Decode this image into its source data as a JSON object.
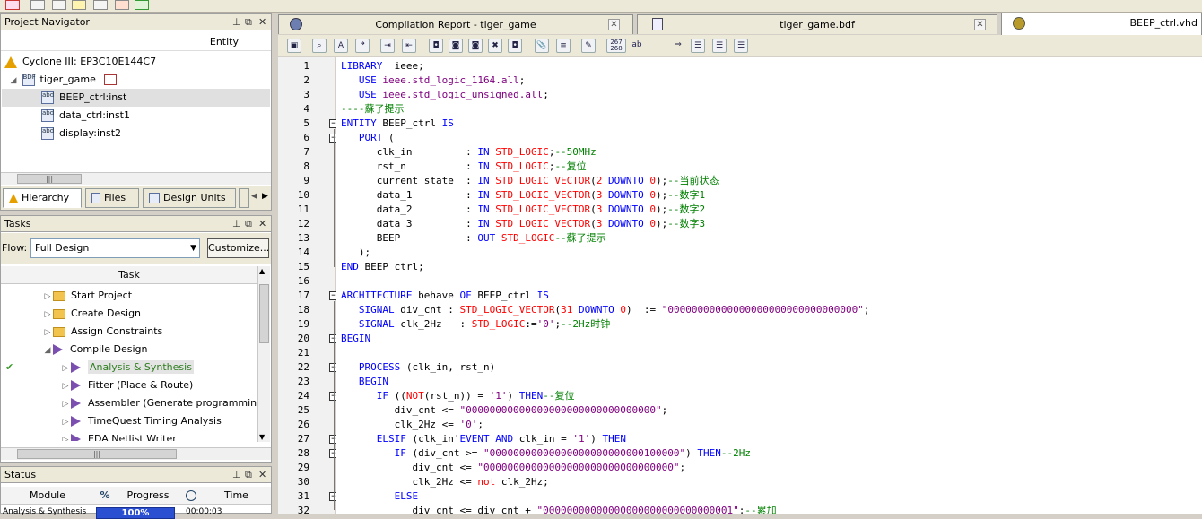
{
  "nav": {
    "title": "Project Navigator",
    "column": "Entity",
    "device": "Cyclone III: EP3C10E144C7",
    "top": "tiger_game",
    "children": [
      "BEEP_ctrl:inst",
      "data_ctrl:inst1",
      "display:inst2"
    ],
    "tabs": [
      "Hierarchy",
      "Files",
      "Design Units"
    ]
  },
  "tasks": {
    "title": "Tasks",
    "flow_label": "Flow:",
    "flow_value": "Full Design",
    "customize": "Customize...",
    "col": "Task",
    "items": [
      {
        "label": "Start Project",
        "icon": "folder",
        "indent": 1,
        "status": ""
      },
      {
        "label": "Create Design",
        "icon": "folder",
        "indent": 1,
        "status": ""
      },
      {
        "label": "Assign Constraints",
        "icon": "folder",
        "indent": 1,
        "status": ""
      },
      {
        "label": "Compile Design",
        "icon": "play",
        "indent": 1,
        "status": "",
        "expanded": true
      },
      {
        "label": "Analysis & Synthesis",
        "icon": "play",
        "indent": 2,
        "status": "done",
        "highlight": true
      },
      {
        "label": "Fitter (Place & Route)",
        "icon": "play",
        "indent": 2,
        "status": ""
      },
      {
        "label": "Assembler (Generate programming files)",
        "icon": "play",
        "indent": 2,
        "status": ""
      },
      {
        "label": "TimeQuest Timing Analysis",
        "icon": "play",
        "indent": 2,
        "status": ""
      },
      {
        "label": "EDA Netlist Writer",
        "icon": "play",
        "indent": 2,
        "status": ""
      }
    ]
  },
  "status": {
    "title": "Status",
    "cols": [
      "Module",
      "%",
      "Progress",
      "Time"
    ],
    "row": {
      "module": "Analysis & Synthesis",
      "progress": "100%",
      "progress_value": 100,
      "time": "00:00:03"
    }
  },
  "doc_tabs": [
    "Compilation Report - tiger_game",
    "tiger_game.bdf",
    "BEEP_ctrl.vhd"
  ],
  "code": {
    "lines": [
      [
        [
          "k",
          "LIBRARY"
        ],
        [
          "",
          "  ieee;"
        ]
      ],
      [
        [
          "",
          "   "
        ],
        [
          "k",
          "USE"
        ],
        [
          "",
          ""
        ],
        [
          "s",
          " ieee.std_logic_1164.all"
        ],
        [
          "",
          ";"
        ]
      ],
      [
        [
          "",
          "   "
        ],
        [
          "k",
          "USE"
        ],
        [
          "s",
          " ieee.std_logic_unsigned.all"
        ],
        [
          "",
          ";"
        ]
      ],
      [
        [
          "c",
          "----蘇了提示"
        ]
      ],
      [
        [
          "k",
          "ENTITY"
        ],
        [
          "",
          ""
        ],
        [
          "",
          ""
        ],
        [
          "",
          " BEEP_ctrl "
        ],
        [
          "k",
          "IS"
        ]
      ],
      [
        [
          "",
          "   "
        ],
        [
          "k",
          "PORT"
        ],
        [
          "",
          "",
          " "
        ],
        [
          "",
          ""
        ],
        [
          "",
          " ("
        ]
      ],
      [
        [
          "",
          "      clk_in         : "
        ],
        [
          "k",
          "IN"
        ],
        [
          "",
          " "
        ],
        [
          "t",
          "STD_LOGIC"
        ],
        [
          "",
          ";"
        ],
        [
          "c",
          "--50MHz"
        ]
      ],
      [
        [
          "",
          "      rst_n          : "
        ],
        [
          "k",
          "IN"
        ],
        [
          "",
          " "
        ],
        [
          "t",
          "STD_LOGIC"
        ],
        [
          "",
          ";"
        ],
        [
          "c",
          "--复位"
        ]
      ],
      [
        [
          "",
          "      current_state  : "
        ],
        [
          "k",
          "IN"
        ],
        [
          "",
          " "
        ],
        [
          "t",
          "STD_LOGIC_VECTOR"
        ],
        [
          "",
          "("
        ],
        [
          "t",
          "2"
        ],
        [
          "",
          " "
        ],
        [
          "k",
          "DOWNTO"
        ],
        [
          "",
          " "
        ],
        [
          "t",
          "0"
        ],
        [
          "",
          ");"
        ],
        [
          "c",
          "--当前状态"
        ]
      ],
      [
        [
          "",
          "      data_1         : "
        ],
        [
          "k",
          "IN"
        ],
        [
          "",
          " "
        ],
        [
          "t",
          "STD_LOGIC_VECTOR"
        ],
        [
          "",
          "("
        ],
        [
          "t",
          "3"
        ],
        [
          "",
          " "
        ],
        [
          "k",
          "DOWNTO"
        ],
        [
          "",
          " "
        ],
        [
          "t",
          "0"
        ],
        [
          "",
          ");"
        ],
        [
          "c",
          "--数字1"
        ]
      ],
      [
        [
          "",
          "      data_2         : "
        ],
        [
          "k",
          "IN"
        ],
        [
          "",
          " "
        ],
        [
          "t",
          "STD_LOGIC_VECTOR"
        ],
        [
          "",
          "("
        ],
        [
          "t",
          "3"
        ],
        [
          "",
          " "
        ],
        [
          "k",
          "DOWNTO"
        ],
        [
          "",
          " "
        ],
        [
          "t",
          "0"
        ],
        [
          "",
          ");"
        ],
        [
          "c",
          "--数字2"
        ]
      ],
      [
        [
          "",
          "      data_3         : "
        ],
        [
          "k",
          "IN"
        ],
        [
          "",
          " "
        ],
        [
          "t",
          "STD_LOGIC_VECTOR"
        ],
        [
          "",
          "("
        ],
        [
          "t",
          "3"
        ],
        [
          "",
          " "
        ],
        [
          "k",
          "DOWNTO"
        ],
        [
          "",
          " "
        ],
        [
          "t",
          "0"
        ],
        [
          "",
          ");"
        ],
        [
          "c",
          "--数字3"
        ]
      ],
      [
        [
          "",
          "      BEEP           : "
        ],
        [
          "k",
          "OUT"
        ],
        [
          "",
          " "
        ],
        [
          "t",
          "STD_LOGIC"
        ],
        [
          "c",
          "--蘇了提示"
        ]
      ],
      [
        [
          "",
          "   );"
        ]
      ],
      [
        [
          "k",
          "END"
        ],
        [
          "",
          " BEEP_ctrl;"
        ]
      ],
      [
        [
          "",
          ""
        ]
      ],
      [
        [
          "k",
          "ARCHITECTURE"
        ],
        [
          "",
          " behave "
        ],
        [
          "k",
          "OF"
        ],
        [
          "",
          " BEEP_ctrl "
        ],
        [
          "k",
          "IS"
        ]
      ],
      [
        [
          "",
          "   "
        ],
        [
          "k",
          "SIGNAL"
        ],
        [
          "",
          " div_cnt : "
        ],
        [
          "t",
          "STD_LOGIC_VECTOR"
        ],
        [
          "",
          "("
        ],
        [
          "t",
          "31"
        ],
        [
          "",
          " "
        ],
        [
          "k",
          "DOWNTO"
        ],
        [
          "",
          " "
        ],
        [
          "t",
          "0"
        ],
        [
          "",
          ")  := "
        ],
        [
          "s",
          "\"00000000000000000000000000000000\""
        ],
        [
          "",
          ";"
        ]
      ],
      [
        [
          "",
          "   "
        ],
        [
          "k",
          "SIGNAL"
        ],
        [
          "",
          " clk_2Hz   : "
        ],
        [
          "t",
          "STD_LOGIC"
        ],
        [
          "",
          ":="
        ],
        [
          "s",
          "'0'"
        ],
        [
          "",
          ";"
        ],
        [
          "c",
          "--2Hz时钟"
        ]
      ],
      [
        [
          "k",
          "BEGIN"
        ]
      ],
      [
        [
          "",
          ""
        ]
      ],
      [
        [
          "",
          "   "
        ],
        [
          "k",
          "PROCESS"
        ],
        [
          "",
          " (clk_in, rst_n)"
        ]
      ],
      [
        [
          "",
          "   "
        ],
        [
          "k",
          "BEGIN"
        ]
      ],
      [
        [
          "",
          "      "
        ],
        [
          "k",
          "IF"
        ],
        [
          "",
          " (("
        ],
        [
          "t",
          "NOT"
        ],
        [
          "",
          "(rst_n)) = "
        ],
        [
          "s",
          "'1'"
        ],
        [
          "",
          ") "
        ],
        [
          "k",
          "THEN"
        ],
        [
          "c",
          "--复位"
        ]
      ],
      [
        [
          "",
          "         div_cnt <= "
        ],
        [
          "s",
          "\"00000000000000000000000000000000\""
        ],
        [
          "",
          ";"
        ]
      ],
      [
        [
          "",
          "         clk_2Hz <= "
        ],
        [
          "s",
          "'0'"
        ],
        [
          "",
          ";"
        ]
      ],
      [
        [
          "",
          "      "
        ],
        [
          "k",
          "ELSIF"
        ],
        [
          "",
          " (clk_in'"
        ],
        [
          "k",
          "EVENT"
        ],
        [
          "",
          " "
        ],
        [
          "k",
          "AND"
        ],
        [
          "",
          " clk_in = "
        ],
        [
          "s",
          "'1'"
        ],
        [
          "",
          ") "
        ],
        [
          "k",
          "THEN"
        ]
      ],
      [
        [
          "",
          "         "
        ],
        [
          "k",
          "IF"
        ],
        [
          "",
          " (div_cnt >= "
        ],
        [
          "s",
          "\"00000000000000000000000000100000\""
        ],
        [
          "",
          ") "
        ],
        [
          "k",
          "THEN"
        ],
        [
          "c",
          "--2Hz"
        ]
      ],
      [
        [
          "",
          "            div_cnt <= "
        ],
        [
          "s",
          "\"00000000000000000000000000000000\""
        ],
        [
          "",
          ";"
        ]
      ],
      [
        [
          "",
          "            clk_2Hz <= "
        ],
        [
          "t",
          "not"
        ],
        [
          "",
          " clk_2Hz;"
        ]
      ],
      [
        [
          "",
          "         "
        ],
        [
          "k",
          "ELSE"
        ]
      ],
      [
        [
          "",
          "            div_cnt <= div_cnt + "
        ],
        [
          "s",
          "\"00000000000000000000000000000001\""
        ],
        [
          "",
          ";"
        ],
        [
          "c",
          "--累加"
        ]
      ]
    ]
  }
}
